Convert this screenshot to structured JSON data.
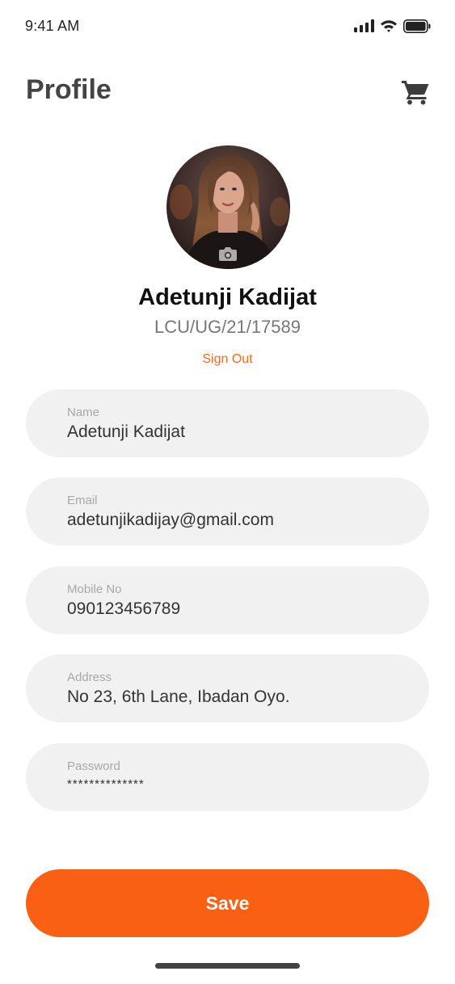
{
  "status_bar": {
    "time": "9:41 AM",
    "icons": [
      "signal-icon",
      "wifi-icon",
      "battery-icon"
    ]
  },
  "header": {
    "title": "Profile",
    "cart_icon": "cart-icon"
  },
  "profile": {
    "name": "Adetunji Kadijat",
    "id_number": "LCU/UG/21/17589",
    "sign_out_label": "Sign Out",
    "camera_icon": "camera-icon"
  },
  "form": {
    "name": {
      "label": "Name",
      "value": "Adetunji Kadijat"
    },
    "email": {
      "label": "Email",
      "value": "adetunjikadijay@gmail.com"
    },
    "mobile": {
      "label": "Mobile No",
      "value": "090123456789"
    },
    "address": {
      "label": "Address",
      "value": "No 23, 6th Lane, Ibadan Oyo."
    },
    "password": {
      "label": "Password",
      "value": "**************"
    }
  },
  "save_label": "Save",
  "colors": {
    "accent": "#fa6014",
    "sign_out": "#f26a1b",
    "field_bg": "#f1f1f1",
    "title": "#444444"
  }
}
